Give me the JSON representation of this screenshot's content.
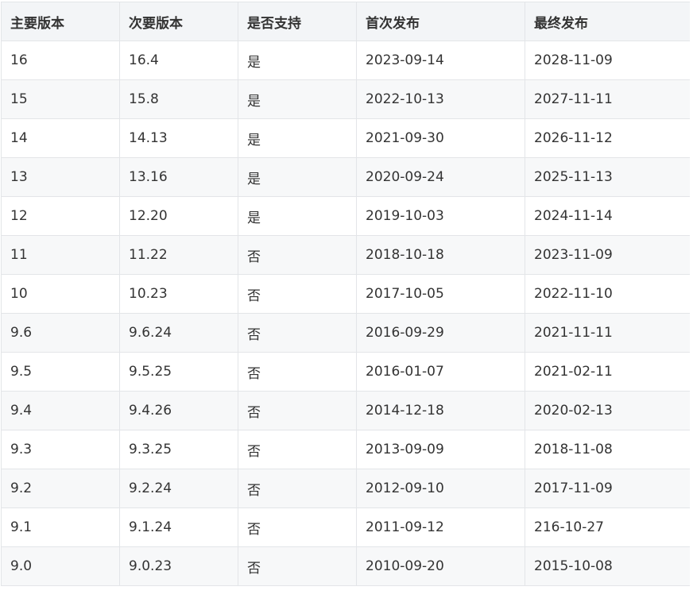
{
  "table": {
    "headers": [
      "主要版本",
      "次要版本",
      "是否支持",
      "首次发布",
      "最终发布"
    ],
    "rows": [
      [
        "16",
        "16.4",
        "是",
        "2023-09-14",
        "2028-11-09"
      ],
      [
        "15",
        "15.8",
        "是",
        "2022-10-13",
        "2027-11-11"
      ],
      [
        "14",
        "14.13",
        "是",
        "2021-09-30",
        "2026-11-12"
      ],
      [
        "13",
        "13.16",
        "是",
        "2020-09-24",
        "2025-11-13"
      ],
      [
        "12",
        "12.20",
        "是",
        "2019-10-03",
        "2024-11-14"
      ],
      [
        "11",
        "11.22",
        "否",
        "2018-10-18",
        "2023-11-09"
      ],
      [
        "10",
        "10.23",
        "否",
        "2017-10-05",
        "2022-11-10"
      ],
      [
        "9.6",
        "9.6.24",
        "否",
        "2016-09-29",
        "2021-11-11"
      ],
      [
        "9.5",
        "9.5.25",
        "否",
        "2016-01-07",
        "2021-02-11"
      ],
      [
        "9.4",
        "9.4.26",
        "否",
        "2014-12-18",
        "2020-02-13"
      ],
      [
        "9.3",
        "9.3.25",
        "否",
        "2013-09-09",
        "2018-11-08"
      ],
      [
        "9.2",
        "9.2.24",
        "否",
        "2012-09-10",
        "2017-11-09"
      ],
      [
        "9.1",
        "9.1.24",
        "否",
        "2011-09-12",
        "216-10-27"
      ],
      [
        "9.0",
        "9.0.23",
        "否",
        "2010-09-20",
        "2015-10-08"
      ]
    ]
  },
  "colors": {
    "header_bg": "#f3f5f7",
    "stripe_bg": "#f7f8f9",
    "border": "#e3e5e8",
    "text": "#333333"
  }
}
